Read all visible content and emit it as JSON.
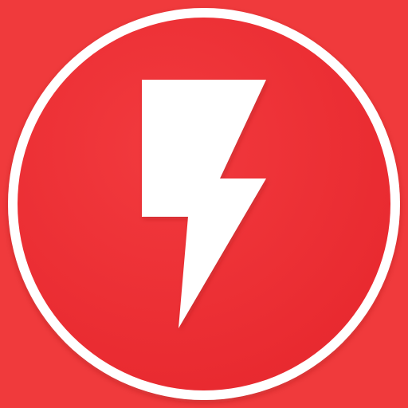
{
  "app_icon": {
    "icon": "lightning-bolt-icon",
    "colors": {
      "background": "#f03a3c",
      "ring": "#ffffff",
      "disc": "#ee2f35",
      "bolt": "#ffffff"
    }
  }
}
